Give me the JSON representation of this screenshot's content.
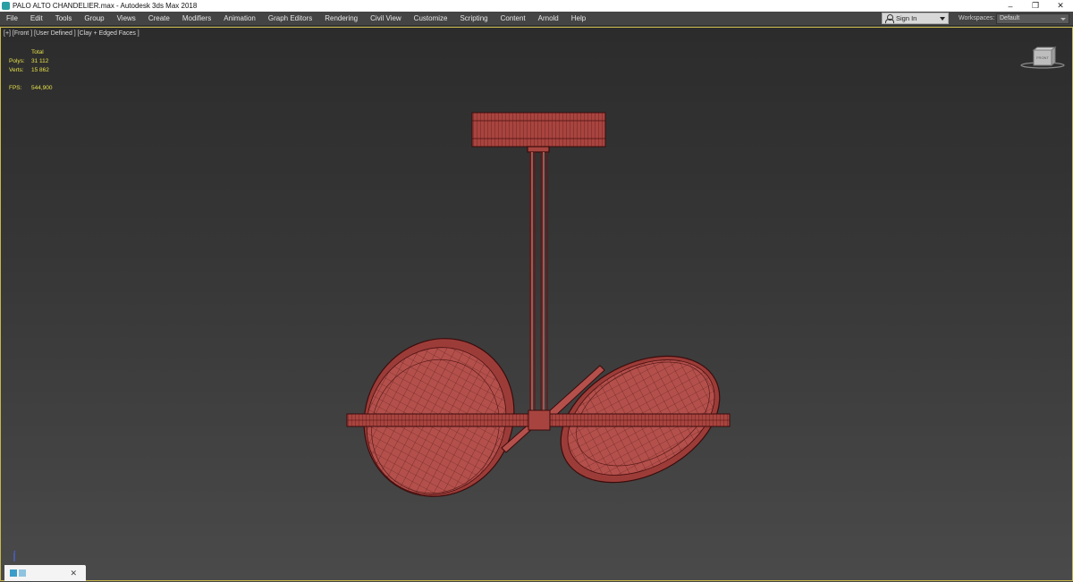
{
  "window": {
    "title": "PALO ALTO CHANDELIER.max - Autodesk 3ds Max 2018",
    "buttons": {
      "minimize": "–",
      "restore": "❐",
      "close": "✕"
    }
  },
  "menu": [
    "File",
    "Edit",
    "Tools",
    "Group",
    "Views",
    "Create",
    "Modifiers",
    "Animation",
    "Graph Editors",
    "Rendering",
    "Civil View",
    "Customize",
    "Scripting",
    "Content",
    "Arnold",
    "Help"
  ],
  "signin": {
    "label": "Sign In"
  },
  "workspaces": {
    "label": "Workspaces:",
    "value": "Default"
  },
  "viewport": {
    "label": "[+] [Front ] [User Defined ] [Clay + Edged Faces ]",
    "stats": {
      "header": "Total",
      "polys_label": "Polys:",
      "polys": "31 112",
      "verts_label": "Verts:",
      "verts": "15 862",
      "fps_label": "FPS:",
      "fps": "544,900"
    },
    "viewcube_face": "FRONT",
    "axis_label": "z"
  },
  "colors": {
    "model_fill": "#b4504c",
    "model_edge": "#4a1010",
    "stats_text": "#e6e04a",
    "viewport_border": "#c8b64a"
  }
}
